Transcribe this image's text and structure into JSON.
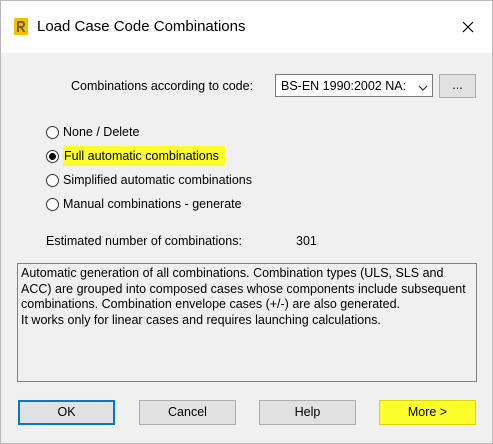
{
  "window": {
    "title": "Load Case Code Combinations",
    "app_icon": "robot-app-icon",
    "close_icon": "close-icon"
  },
  "code": {
    "label": "Combinations according to code:",
    "selected": "BS-EN 1990:2002 NA:",
    "browse_label": "..."
  },
  "options": [
    {
      "label": "None / Delete",
      "checked": false
    },
    {
      "label": "Full automatic combinations",
      "checked": true,
      "highlighted": true
    },
    {
      "label": "Simplified automatic combinations",
      "checked": false
    },
    {
      "label": "Manual combinations - generate",
      "checked": false
    }
  ],
  "estimate": {
    "label": "Estimated number of combinations:",
    "value": "301"
  },
  "description": {
    "paragraph1": "Automatic generation of all combinations. Combination types (ULS, SLS and ACC) are grouped into composed cases whose components include subsequent combinations. Combination envelope cases (+/-) are also generated.",
    "paragraph2": "It works only for linear cases and requires launching calculations."
  },
  "buttons": {
    "ok": "OK",
    "cancel": "Cancel",
    "help": "Help",
    "more": "More >"
  },
  "colors": {
    "highlight": "#fdfd2b",
    "focus": "#0078d7",
    "dialog_bg": "#f0f0f0"
  }
}
